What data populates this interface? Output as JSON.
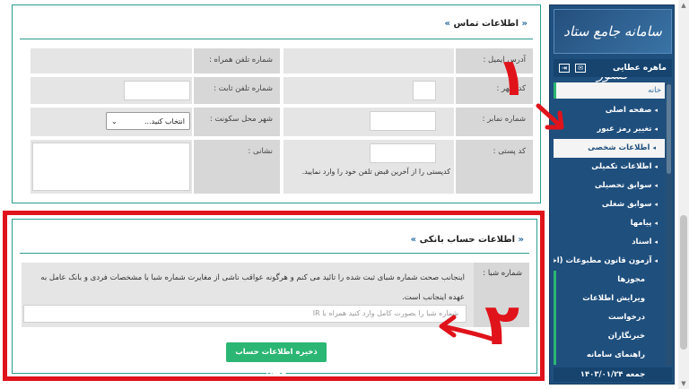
{
  "sidebar": {
    "logo_text": "سامانه جامع ستاد کشور",
    "user_name": "ماهره عطایی",
    "menu": [
      {
        "label": "خانه",
        "kind": "home"
      },
      {
        "label": "صفحه اصلی",
        "kind": "item"
      },
      {
        "label": "تغییر رمز عبور",
        "kind": "item"
      },
      {
        "label": "اطلاعات شخصی",
        "kind": "active"
      },
      {
        "label": "اطلاعات تکمیلی",
        "kind": "item"
      },
      {
        "label": "سوابق تحصیلی",
        "kind": "item"
      },
      {
        "label": "سوابق شغلی",
        "kind": "item"
      },
      {
        "label": "پیامها",
        "kind": "item"
      },
      {
        "label": "اسناد",
        "kind": "item"
      },
      {
        "label": "آزمون قانون مطبوعات (اختیاری)",
        "kind": "item"
      },
      {
        "label": "مجوزها",
        "kind": "sub"
      },
      {
        "label": "ویرایش اطلاعات",
        "kind": "sub"
      },
      {
        "label": "درخواست",
        "kind": "sub"
      },
      {
        "label": "خبرنگاران",
        "kind": "sub"
      },
      {
        "label": "راهنمای سامانه",
        "kind": "sub"
      }
    ],
    "date": "جمعه ۱۴۰۳/۰۱/۲۴"
  },
  "contact": {
    "title": "اطلاعات تماس",
    "email_label": "آدرس ایمیل :",
    "mobile_label": "شماره تلفن همراه :",
    "city_code_label": "کد شهر :",
    "phone_label": "شماره تلفن ثابت :",
    "fax_label": "شماره نمابر :",
    "city_label": "شهر محل سکونت :",
    "city_select_value": "انتخاب کنید...",
    "postal_label": "کد پستی :",
    "postal_hint": "کدپستی را از آخرین قبض تلفن خود را وارد نمایید.",
    "address_label": "نشانی :"
  },
  "bank": {
    "title": "اطلاعات حساب بانکی",
    "sheba_label": "شماره شبا :",
    "sheba_note": "اینجانب صحت شماره شبای ثبت شده را تائید می کنم و هرگونه عواقب ناشی از مغایرت شماره شبا با مشخصات فردی و بانک عامل به عهده اینجانب است.",
    "sheba_placeholder": "شماره شبا را بصورت کامل وارد کنید همراه با IR",
    "save_button": "ذخیره اطلاعات حساب بانکی"
  },
  "annotations": {
    "step1": "۱",
    "step2": "۲"
  },
  "colors": {
    "sidebar": "#1f4f7d",
    "accent_green": "#2bb673",
    "panel_border": "#2a9d8f",
    "annotation_red": "#e0131b"
  }
}
